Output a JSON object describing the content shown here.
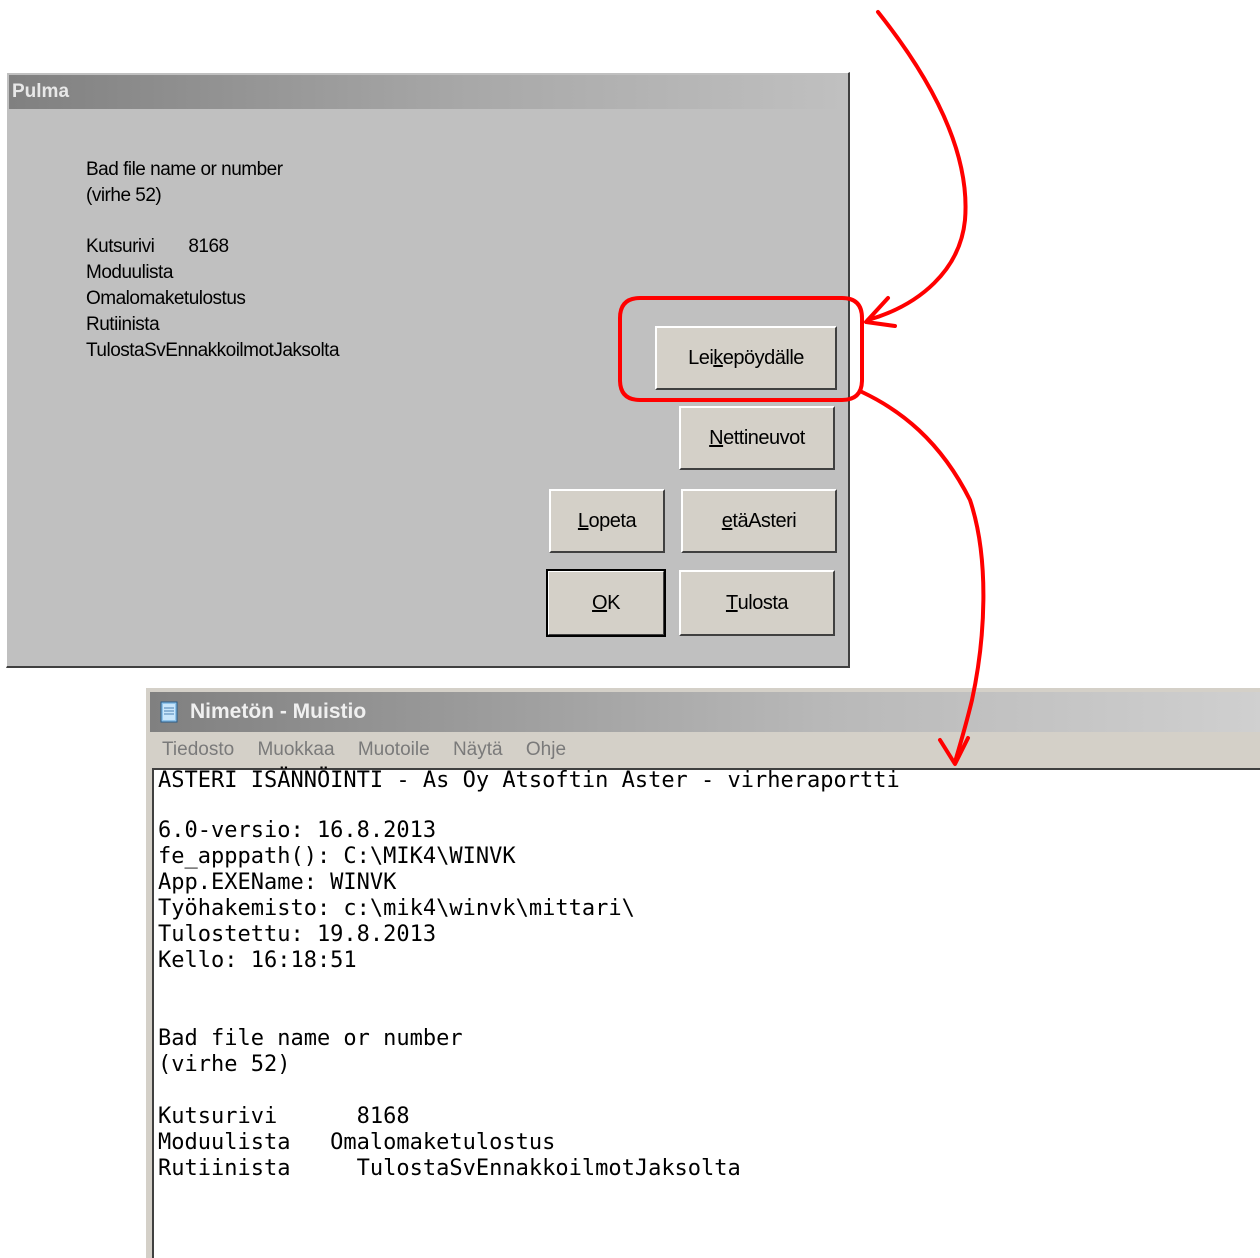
{
  "dialog": {
    "title": "Pulma",
    "error_line1": "Bad file name or number",
    "error_line2": "(virhe 52)",
    "kutsurivi_label": "Kutsurivi",
    "kutsurivi_value": "8168",
    "module_label": "Moduulista",
    "module_value": "Omalomaketulostus",
    "routine_label": "Rutiinista",
    "routine_value": "TulostaSvEnnakkoilmotJaksolta",
    "buttons": {
      "clipboard": {
        "pre": "Lei",
        "mnemonic": "k",
        "post": "epöydälle"
      },
      "net_help": {
        "pre": "",
        "mnemonic": "N",
        "post": "ettineuvot"
      },
      "quit": {
        "pre": "",
        "mnemonic": "L",
        "post": "opeta"
      },
      "remote": {
        "pre": "",
        "mnemonic": "e",
        "post": "täAsteri"
      },
      "ok": {
        "pre": "",
        "mnemonic": "O",
        "post": "K"
      },
      "print": {
        "pre": "",
        "mnemonic": "T",
        "post": "ulosta"
      }
    }
  },
  "notepad": {
    "title": "Nimetön - Muistio",
    "menu": [
      "Tiedosto",
      "Muokkaa",
      "Muotoile",
      "Näytä",
      "Ohje"
    ],
    "lines": [
      "ASTERI ISÄNNÖINTI - As Oy Atsoftin Aster - virheraportti",
      "6.0-versio: 16.8.2013",
      "fe_apppath(): C:\\MIK4\\WINVK",
      "App.EXEName: WINVK",
      "Työhakemisto: c:\\mik4\\winvk\\mittari\\",
      "Tulostettu: 19.8.2013",
      "Kello: 16:18:51",
      "Bad file name or number",
      "(virhe 52)",
      "Kutsurivi      8168",
      "Moduulista   Omalomaketulostus",
      "Rutiinista     TulostaSvEnnakkoilmotJaksolta"
    ]
  },
  "colors": {
    "annotation": "#ff0000",
    "dialog_bg": "#c0c0c0",
    "button_face": "#d4d0c8"
  }
}
